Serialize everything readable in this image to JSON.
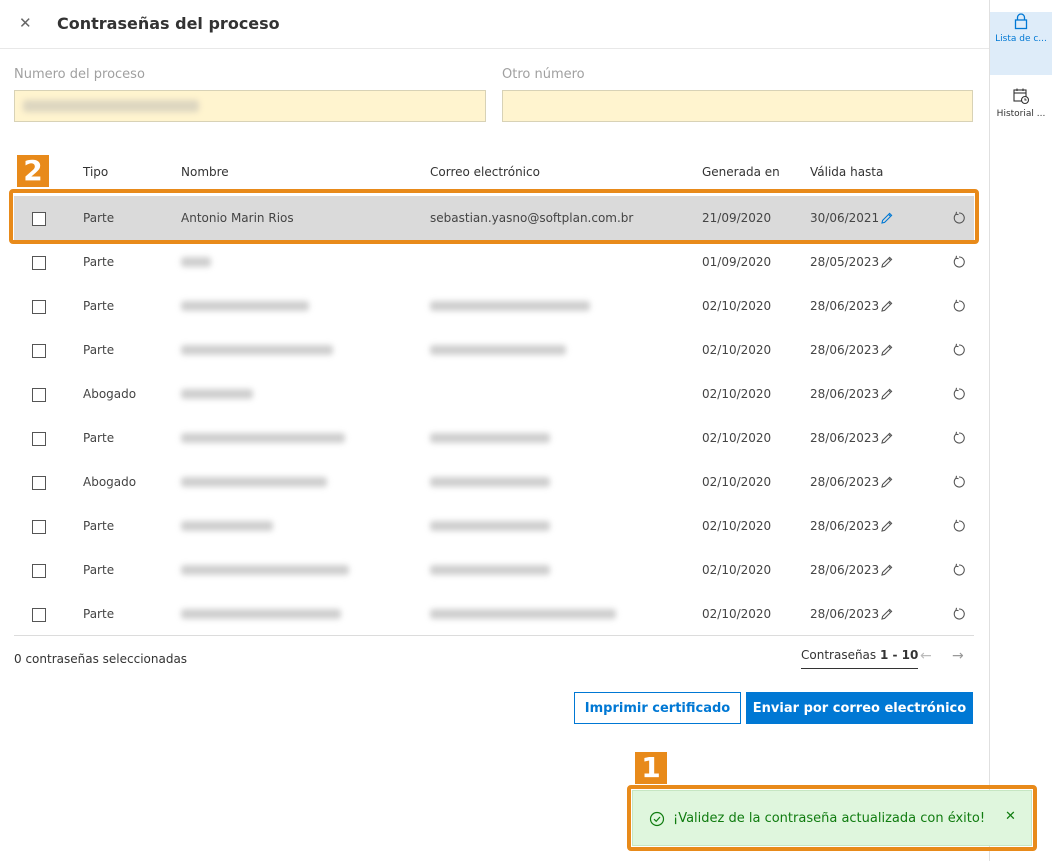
{
  "header": {
    "title": "Contraseñas del proceso",
    "close_glyph": "✕"
  },
  "right_panel": {
    "items": [
      {
        "label": "Lista de c...",
        "icon": "lock-icon",
        "active": true
      },
      {
        "label": "Historial ...",
        "icon": "calendar-clock-icon",
        "active": false
      }
    ]
  },
  "fields": {
    "process_number_label": "Numero del proceso",
    "other_number_label": "Otro número"
  },
  "table": {
    "headers": [
      "Tipo",
      "Nombre",
      "Correo electrónico",
      "Generada en",
      "Válida hasta"
    ],
    "rows": [
      {
        "tipo": "Parte",
        "nombre": "Antonio Marin Rios",
        "correo": "sebastian.yasno@softplan.com.br",
        "generada": "21/09/2020",
        "valida": "30/06/2021"
      },
      {
        "tipo": "Parte",
        "nombre": "",
        "correo": "",
        "generada": "01/09/2020",
        "valida": "28/05/2023"
      },
      {
        "tipo": "Parte",
        "nombre": "",
        "correo": "",
        "generada": "02/10/2020",
        "valida": "28/06/2023"
      },
      {
        "tipo": "Parte",
        "nombre": "",
        "correo": "",
        "generada": "02/10/2020",
        "valida": "28/06/2023"
      },
      {
        "tipo": "Abogado",
        "nombre": "",
        "correo": "",
        "generada": "02/10/2020",
        "valida": "28/06/2023"
      },
      {
        "tipo": "Parte",
        "nombre": "",
        "correo": "",
        "generada": "02/10/2020",
        "valida": "28/06/2023"
      },
      {
        "tipo": "Abogado",
        "nombre": "",
        "correo": "",
        "generada": "02/10/2020",
        "valida": "28/06/2023"
      },
      {
        "tipo": "Parte",
        "nombre": "",
        "correo": "",
        "generada": "02/10/2020",
        "valida": "28/06/2023"
      },
      {
        "tipo": "Parte",
        "nombre": "",
        "correo": "",
        "generada": "02/10/2020",
        "valida": "28/06/2023"
      },
      {
        "tipo": "Parte",
        "nombre": "",
        "correo": "",
        "generada": "02/10/2020",
        "valida": "28/06/2023"
      }
    ]
  },
  "footer": {
    "selected_count": "0 contraseñas seleccionadas",
    "pager_label": "Contraseñas",
    "pager_range": "1 - 10",
    "prev_glyph": "←",
    "next_glyph": "→"
  },
  "buttons": {
    "print": "Imprimir certificado",
    "email": "Enviar por correo electrónico"
  },
  "toast": {
    "message": "¡Validez de la contraseña actualizada con éxito!",
    "close_glyph": "✕"
  },
  "annotations": {
    "badge_1": "1",
    "badge_2": "2"
  },
  "colors": {
    "accent": "#0078d4",
    "highlight": "#e88a1a",
    "success_bg": "#dff6dd",
    "success_text": "#107c10",
    "field_bg": "#fff4cf"
  }
}
